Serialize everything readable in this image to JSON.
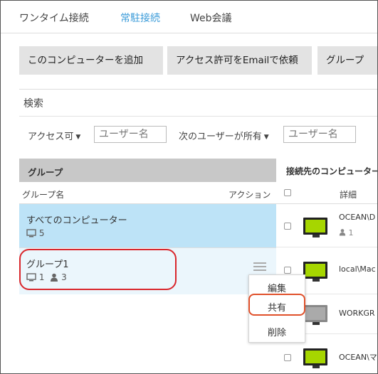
{
  "tabs": [
    {
      "label": "ワンタイム接続",
      "active": false
    },
    {
      "label": "常駐接続",
      "active": true
    },
    {
      "label": "Web会議",
      "active": false
    }
  ],
  "actions": {
    "add_computer": "このコンピューターを追加",
    "request_access": "アクセス許可をEmailで依頼",
    "group": "グループ"
  },
  "search": {
    "label": "検索"
  },
  "filters": {
    "access": "アクセス可",
    "user_placeholder": "ユーザー名",
    "owned_by": "次のユーザーが所有",
    "owner_placeholder": "ユーザー名"
  },
  "groups_panel": {
    "header": "グループ",
    "col_name": "グループ名",
    "col_action": "アクション",
    "rows": [
      {
        "name": "すべてのコンピューター",
        "computers": "5",
        "users": ""
      },
      {
        "name": "グループ1",
        "computers": "1",
        "users": "3"
      }
    ]
  },
  "computers_panel": {
    "header": "接続先のコンピューター",
    "col_detail": "詳細",
    "rows": [
      {
        "name": "OCEAN\\D",
        "user": "1",
        "status": "online"
      },
      {
        "name": "local\\Mac",
        "user": "",
        "status": "online"
      },
      {
        "name": "WORKGR",
        "user": "",
        "status": "offline"
      },
      {
        "name": "OCEAN\\マ",
        "user": "",
        "status": "online"
      }
    ]
  },
  "context_menu": {
    "edit": "編集",
    "share": "共有",
    "delete": "削除"
  },
  "colors": {
    "accent": "#3a9bd9",
    "online": "#a6d600",
    "highlight": "#d9262c",
    "selected_row": "#bde3f7"
  }
}
